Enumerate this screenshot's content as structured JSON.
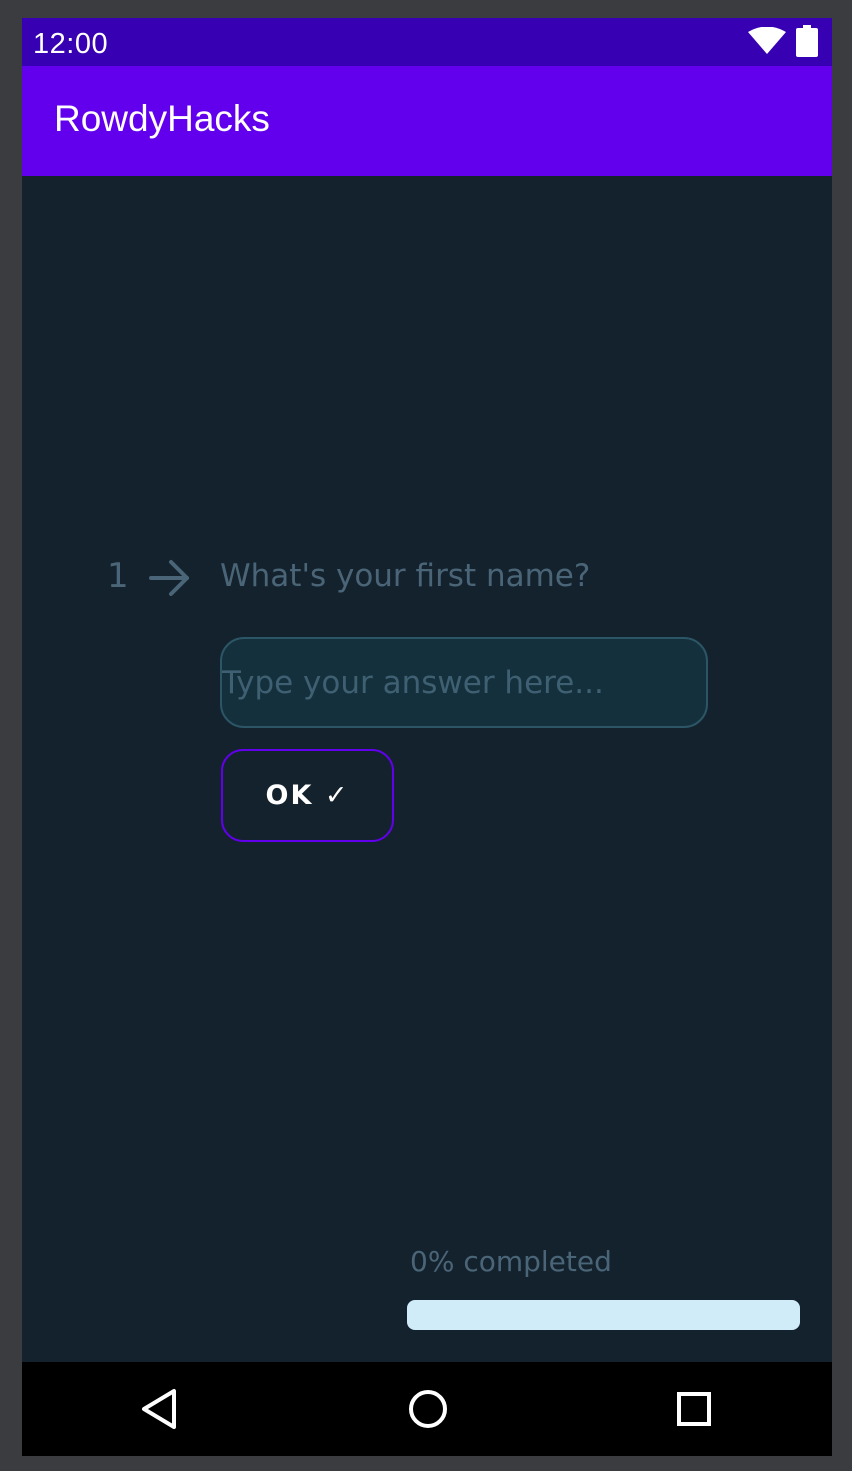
{
  "status_bar": {
    "time": "12:00",
    "icons": [
      "wifi-icon",
      "battery-icon"
    ]
  },
  "app_bar": {
    "title": "RowdyHacks"
  },
  "question": {
    "number": "1",
    "arrow_icon": "arrow-right-icon",
    "text": "What's your first name?"
  },
  "answer": {
    "value": "",
    "placeholder": "Type your answer here..."
  },
  "ok_button": {
    "label": "OK ✓"
  },
  "progress": {
    "label": "0% completed",
    "percent": 0
  },
  "nav_bar": {
    "icons": [
      "back-triangle-icon",
      "home-circle-icon",
      "recents-square-icon"
    ]
  },
  "colors": {
    "status_bar": "#3700b3",
    "app_bar": "#6200ee",
    "background": "#14222d",
    "muted_text": "#4a6577",
    "input_bg": "#14303c",
    "input_border": "#2c5566",
    "accent": "#6200ee",
    "progress_track": "#d1ecf9"
  }
}
